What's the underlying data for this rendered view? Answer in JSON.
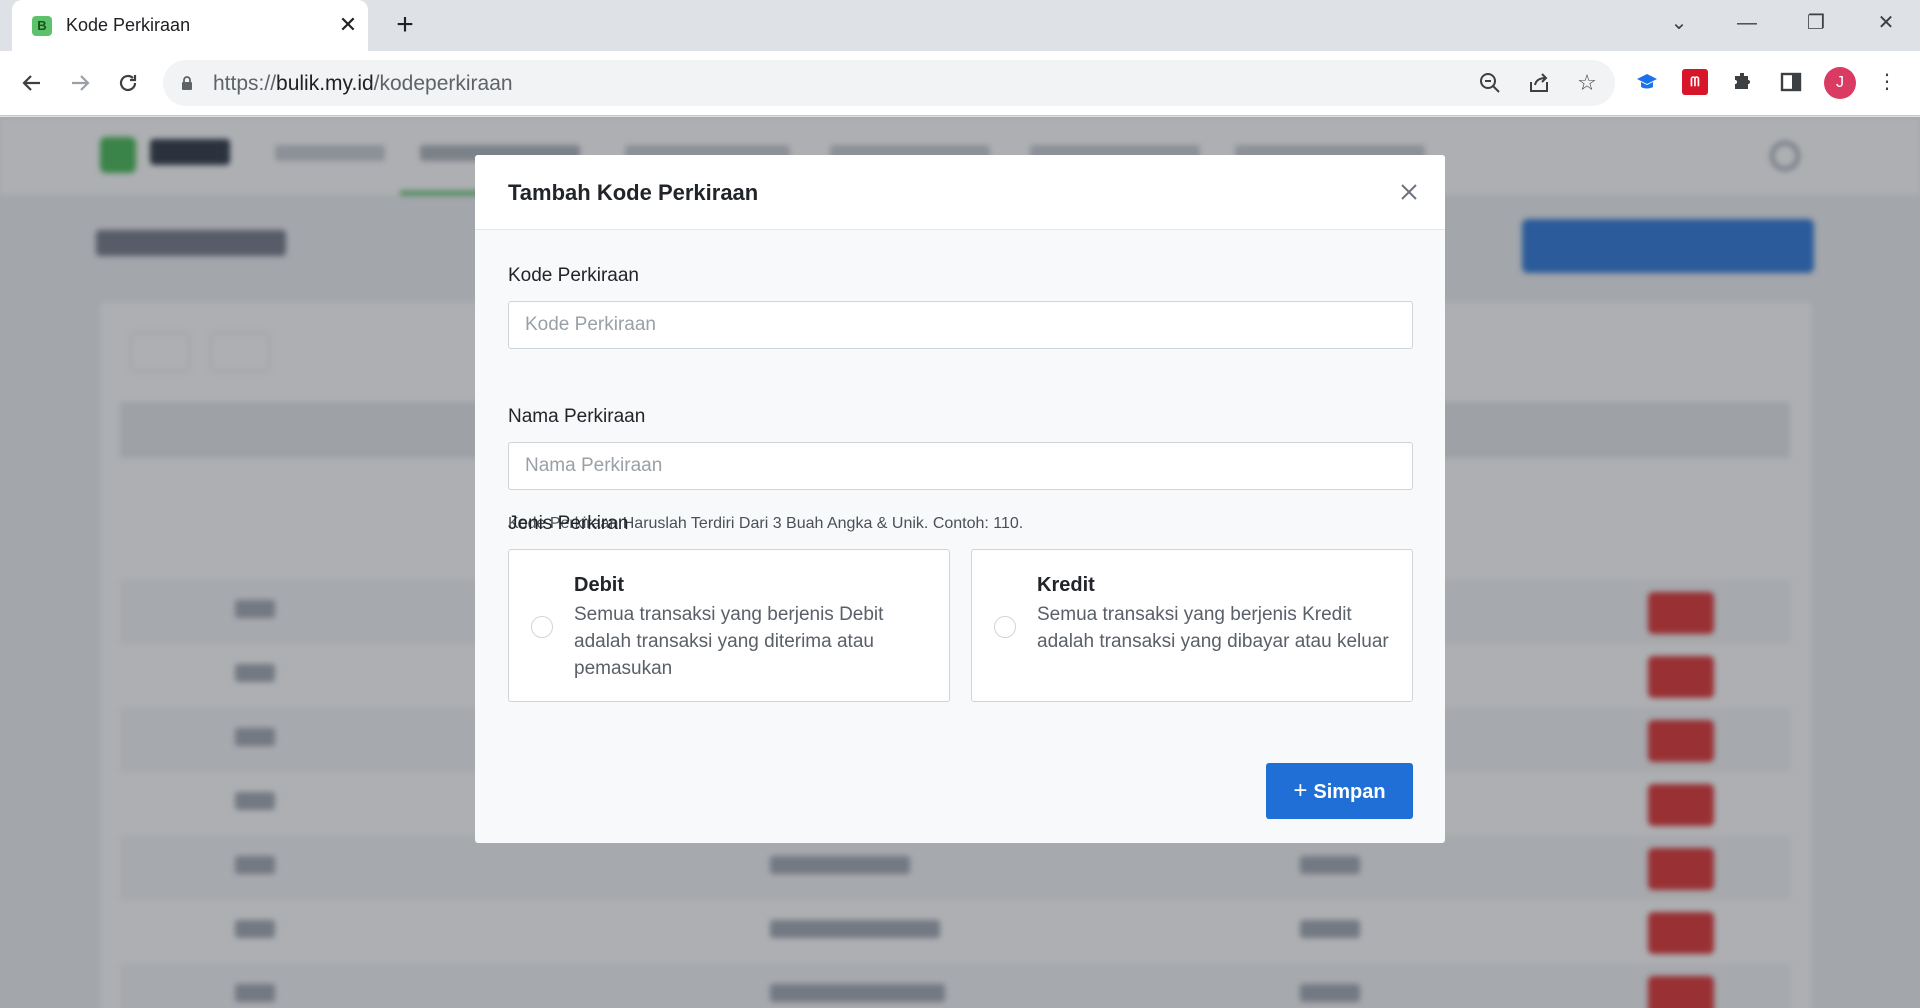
{
  "browser": {
    "tab_title": "Kode Perkiraan",
    "favicon_letter": "B",
    "url_prefix": "https://",
    "url_host": "bulik.my.id",
    "url_path": "/kodeperkiraan",
    "profile_initial": "J"
  },
  "icons": {
    "back": "arrow-left-icon",
    "forward": "arrow-right-icon",
    "reload": "reload-icon",
    "zoom": "zoom-out-icon",
    "share": "share-icon",
    "bookmark": "star-icon",
    "extensions": "puzzle-icon",
    "sidepanel": "side-panel-icon",
    "menu": "kebab-menu-icon"
  },
  "modal": {
    "title": "Tambah Kode Perkiraan",
    "kode": {
      "label": "Kode Perkiraan",
      "placeholder": "Kode Perkiraan",
      "value": "",
      "help": "Kode Perkiraan Haruslah Terdiri Dari 3 Buah Angka & Unik. Contoh: 110."
    },
    "nama": {
      "label": "Nama Perkiraan",
      "placeholder": "Nama Perkiraan",
      "value": ""
    },
    "jenis": {
      "label": "Jenis Perkiran",
      "options": [
        {
          "title": "Debit",
          "description": "Semua transaksi yang berjenis Debit adalah transaksi yang diterima atau pemasukan",
          "selected": false
        },
        {
          "title": "Kredit",
          "description": "Semua transaksi yang berjenis Kredit adalah transaksi yang dibayar atau keluar",
          "selected": false
        }
      ]
    },
    "save_label": "Simpan"
  },
  "colors": {
    "primary": "#1f6fd6",
    "danger": "#dc2626",
    "brand": "#3bb54a",
    "avatar": "#d93b63"
  }
}
